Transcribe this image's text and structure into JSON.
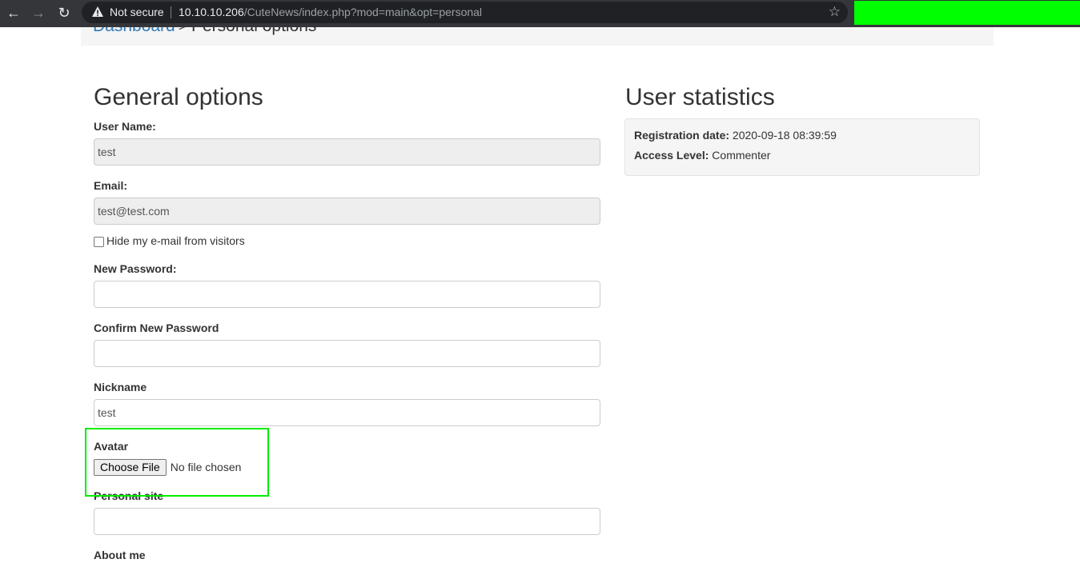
{
  "browser": {
    "security_label": "Not secure",
    "url_host": "10.10.10.206",
    "url_path": "/CuteNews/index.php?mod=main&opt=personal",
    "extension_color": "#00ff00"
  },
  "breadcrumb": {
    "parent": "Dashboard",
    "separator": ">",
    "current": "Personal options"
  },
  "general": {
    "title": "General options",
    "username_label": "User Name:",
    "username_value": "test",
    "email_label": "Email:",
    "email_value": "test@test.com",
    "hide_email_label": "Hide my e-mail from visitors",
    "new_password_label": "New Password:",
    "confirm_password_label": "Confirm New Password",
    "nickname_label": "Nickname",
    "nickname_value": "test",
    "avatar_label": "Avatar",
    "choose_file_label": "Choose File",
    "no_file_label": "No file chosen",
    "personal_site_label": "Personal site",
    "about_me_label": "About me"
  },
  "stats": {
    "title": "User statistics",
    "registration_label": "Registration date:",
    "registration_value": "2020-09-18 08:39:59",
    "access_label": "Access Level:",
    "access_value": "Commenter"
  },
  "colors": {
    "link": "#337ab7",
    "highlight": "#00ee00"
  }
}
